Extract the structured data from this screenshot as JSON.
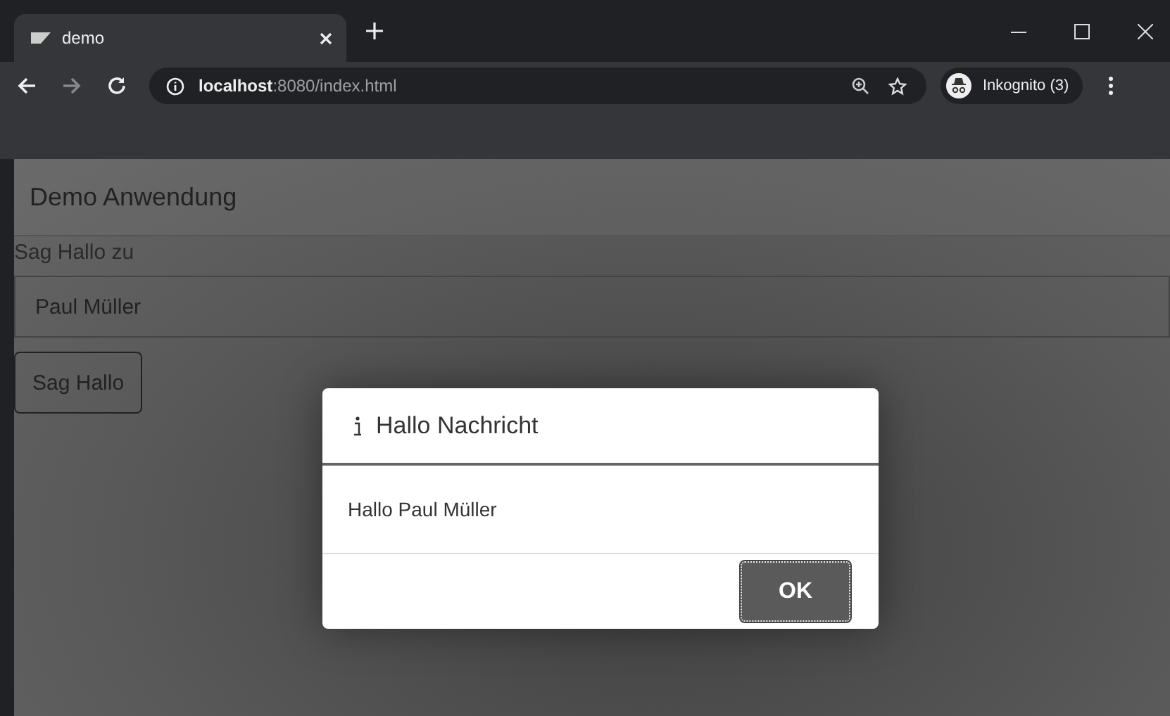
{
  "browser": {
    "tab": {
      "title": "demo"
    },
    "address": {
      "host": "localhost",
      "path": ":8080/index.html"
    },
    "profile": {
      "label": "Inkognito (3)"
    }
  },
  "page": {
    "header": "Demo Anwendung",
    "field_label": "Sag Hallo zu",
    "input": {
      "value": "Paul Müller"
    },
    "button": "Sag Hallo"
  },
  "dialog": {
    "title": "Hallo Nachricht",
    "message": "Hallo Paul Müller",
    "buttons": [
      "OK"
    ]
  }
}
